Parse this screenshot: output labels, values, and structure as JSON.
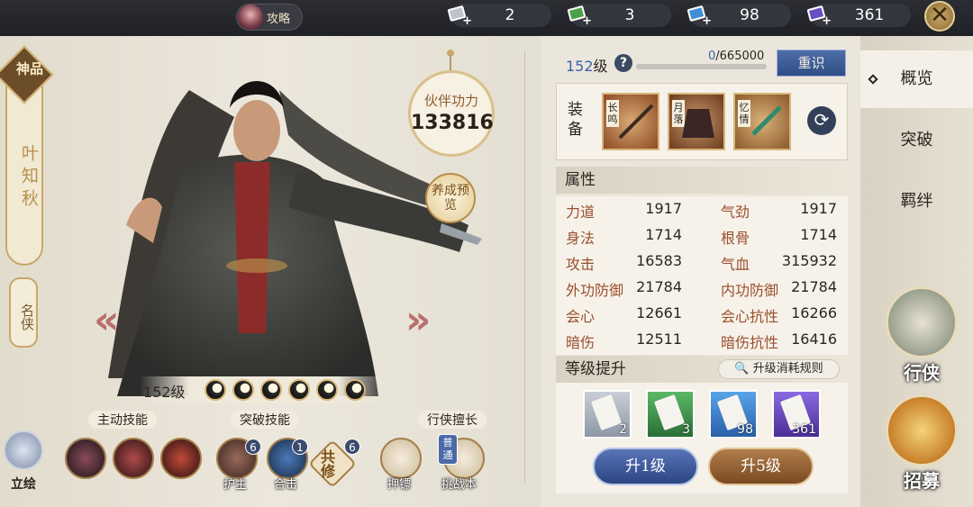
{
  "topbar": {
    "guide_label": "攻略",
    "resources": [
      {
        "icon": "gray-scroll-icon",
        "color": "#bcc3cf",
        "value": "2"
      },
      {
        "icon": "green-scroll-icon",
        "color": "#4ba14b",
        "value": "3"
      },
      {
        "icon": "blue-scroll-icon",
        "color": "#3f8fd8",
        "value": "98"
      },
      {
        "icon": "purple-scroll-icon",
        "color": "#6a4fc4",
        "value": "361"
      }
    ],
    "close_icon": "✕"
  },
  "hero": {
    "grade": "神品",
    "name": "叶知秋",
    "rank": "名侠",
    "power_label": "伙伴功力",
    "power_value": "133816",
    "preview_label": "养成预览",
    "level_label": "152级",
    "lihui_label": "立绘"
  },
  "skills": {
    "active_title": "主动技能",
    "break_title": "突破技能",
    "expertise_title": "行侠擅长",
    "break_items": [
      {
        "label": "护主",
        "badge": "6"
      },
      {
        "label": "合击",
        "badge": "1"
      },
      {
        "label": "共修",
        "badge": "6"
      }
    ],
    "expertise_items": [
      {
        "label": "押镖"
      },
      {
        "label": "挑战本",
        "tag": "普通"
      }
    ]
  },
  "panel": {
    "level": "152",
    "level_suffix": "级",
    "help_icon": "?",
    "exp_current": "0",
    "exp_total": "/665000",
    "exp_progress": 0,
    "reset_label": "重识",
    "equip_label": "装备",
    "equipment": [
      {
        "tag": "长鸣"
      },
      {
        "tag": "月落"
      },
      {
        "tag": "忆情"
      }
    ],
    "attr_title": "属性",
    "attributes": [
      {
        "k1": "力道",
        "v1": "1917",
        "k2": "气劲",
        "v2": "1917"
      },
      {
        "k1": "身法",
        "v1": "1714",
        "k2": "根骨",
        "v2": "1714"
      },
      {
        "k1": "攻击",
        "v1": "16583",
        "k2": "气血",
        "v2": "315932"
      },
      {
        "k1": "外功防御",
        "v1": "21784",
        "k2": "内功防御",
        "v2": "21784"
      },
      {
        "k1": "会心",
        "v1": "12661",
        "k2": "会心抗性",
        "v2": "16266"
      },
      {
        "k1": "暗伤",
        "v1": "12511",
        "k2": "暗伤抗性",
        "v2": "16416"
      }
    ],
    "upgrade_title": "等级提升",
    "rule_label": "升级消耗规则",
    "exp_books": [
      {
        "count": "2",
        "color": "#b7c0cc"
      },
      {
        "count": "3",
        "color": "#3f9a4a"
      },
      {
        "count": "98",
        "color": "#3c86d2"
      },
      {
        "count": "361",
        "color": "#6a4bc2"
      }
    ],
    "btn_up1": "升1级",
    "btn_up5": "升5级"
  },
  "sidebar": {
    "tabs": [
      "概览",
      "突破",
      "羁绊"
    ],
    "xingxia": "行侠",
    "zhaomu": "招募"
  }
}
